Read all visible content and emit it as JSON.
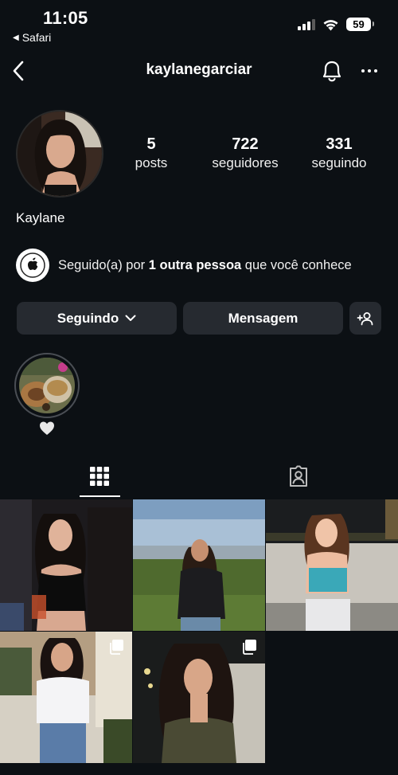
{
  "status_bar": {
    "time": "11:05",
    "back_app": "Safari",
    "battery": "59"
  },
  "header": {
    "username": "kaylanegarciar"
  },
  "profile": {
    "posts_count": "5",
    "posts_label": "posts",
    "followers_count": "722",
    "followers_label": "seguidores",
    "following_count": "331",
    "following_label": "seguindo",
    "display_name": "Kaylane"
  },
  "followed_by": {
    "prefix": "Seguido(a) por ",
    "bold": "1 outra pessoa",
    "suffix": " que você conhece"
  },
  "actions": {
    "following_label": "Seguindo",
    "message_label": "Mensagem"
  },
  "tabs": {
    "active": "grid"
  },
  "colors": {
    "background": "#0c1014",
    "button": "#262a30",
    "text": "#f5f5f5"
  }
}
